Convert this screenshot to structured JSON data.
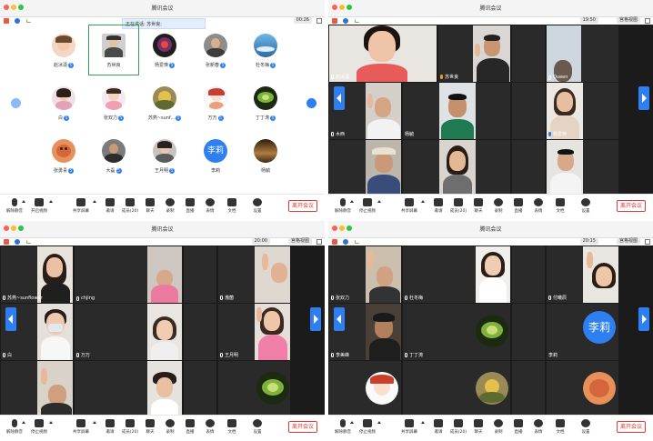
{
  "windows": [
    {
      "title": "腾讯会议",
      "timer": "00:26",
      "speaking": "正在讲话: 苏世良;",
      "participants": [
        {
          "name": "赵冰潇",
          "badge": "5"
        },
        {
          "name": "苏世良",
          "badge": ""
        },
        {
          "name": "杨爱瑛",
          "badge": "5"
        },
        {
          "name": "张新春",
          "badge": "5"
        },
        {
          "name": "杜冬梅",
          "badge": "5"
        },
        {
          "name": "白",
          "badge": "5"
        },
        {
          "name": "张双力",
          "badge": "5"
        },
        {
          "name": "苏燕~sunf...",
          "badge": "5"
        },
        {
          "name": "万万",
          "badge": "5"
        },
        {
          "name": "丁丁涛",
          "badge": "5"
        },
        {
          "name": "张勇青",
          "badge": "5"
        },
        {
          "name": "大磊",
          "badge": "5"
        },
        {
          "name": "王月明",
          "badge": "5"
        },
        {
          "name": "李莉",
          "badge": ""
        },
        {
          "name": "杨毓",
          "badge": ""
        }
      ],
      "avatar_text": "李莉"
    },
    {
      "title": "腾讯会议",
      "timer": "19:50",
      "view_mode": "宫格视图",
      "tiles": [
        "赵冰潇",
        "苏世良",
        "",
        "Queen",
        "木西",
        "杨毓",
        "",
        "杨爱瑛",
        "",
        "",
        "",
        ""
      ]
    },
    {
      "title": "腾讯会议",
      "timer": "20:00",
      "view_mode": "宫格视图",
      "tiles": [
        "苏燕~sunflower",
        "chjing",
        "",
        "渤菌",
        "白",
        "万万",
        "",
        "王月明",
        "",
        "",
        "",
        ""
      ]
    },
    {
      "title": "腾讯会议",
      "timer": "20:15",
      "view_mode": "宫格视图",
      "tiles": [
        "张双力",
        "杜冬梅",
        "",
        "付曦辰",
        "李美峰",
        "丁丁涛",
        "",
        "李莉",
        "",
        "",
        "",
        ""
      ],
      "avatar_text": "李莉"
    }
  ],
  "toolbar": {
    "mute": "解除静音",
    "video_open": "开启视频",
    "video_stop": "停止视频",
    "share": "共享屏幕",
    "invite": "邀请",
    "members": "成员(20)",
    "chat": "聊天",
    "record": "录制",
    "live": "直播",
    "reaction": "表情",
    "docs": "文档",
    "settings": "设置",
    "leave": "离开会议"
  },
  "colors": {
    "accent": "#2d7ff2",
    "leave": "#e53935",
    "tile_bg": "#2a2a2a"
  }
}
